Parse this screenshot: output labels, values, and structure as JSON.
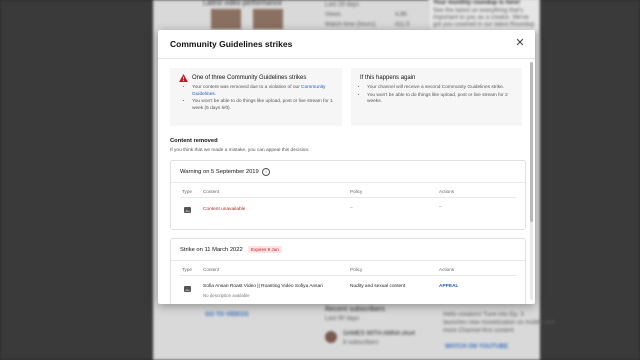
{
  "background": {
    "left_items": [
      "Latest video performance"
    ],
    "stats": [
      "Last 28 days",
      "Views",
      "Watch time (hours)"
    ],
    "stat_values": [
      "4.8K",
      "411.5"
    ],
    "right_card": [
      "Your monthly roundup is here!",
      "See the latest on everything that's",
      "important to you as a creator. We've",
      "got you covered in our latest Roundup"
    ],
    "go_to_videos": "GO TO VIDEOS",
    "recent_subscribers": "Recent subscribers",
    "last_90_days": "Last 90 days",
    "subscriber_name": "GAMES WITH AMNA short",
    "subscriber_meta": "8 subscribers",
    "right_bottom_text": [
      "Hello creators! Tune into Ep. 3",
      "launches new monetization on mobile and",
      "more Channel-first content"
    ],
    "watch_on_youtube": "WATCH ON YOUTUBE"
  },
  "modal": {
    "title": "Community Guidelines strikes",
    "close_icon": "close-icon",
    "strike_box": {
      "title": "One of three Community Guidelines strikes",
      "bullet1_prefix": "Your content was removed due to a violation of our ",
      "bullet1_link": "Community Guidelines",
      "bullet1_suffix": ".",
      "bullet2": "You won't be able to do things like upload, post or live stream for 1 week (5 days left)."
    },
    "again_box": {
      "title": "If this happens again",
      "bullet1": "Your channel will receive a second Community Guidelines strike.",
      "bullet2": "You won't be able to do things like upload, post or live stream for 2 weeks."
    },
    "content_removed": {
      "title": "Content removed",
      "subtitle": "If you think that we made a mistake, you can appeal this decision."
    },
    "warning_card": {
      "title": "Warning on 5 September 2019",
      "headers": {
        "type": "Type",
        "content": "Content",
        "policy": "Policy",
        "actions": "Actions"
      },
      "row": {
        "content": "Content unavailable",
        "policy": "–",
        "actions": "–"
      }
    },
    "strike_card": {
      "title": "Strike on 11 March 2022",
      "badge": "Expires 9 Jun",
      "headers": {
        "type": "Type",
        "content": "Content",
        "policy": "Policy",
        "actions": "Actions"
      },
      "row": {
        "content": "Sofia Ansari Roast Video || Roasting Video Sofiya Ansari",
        "description": "No description available",
        "policy": "Nudity and sexual content",
        "action": "APPEAL"
      }
    }
  },
  "colors": {
    "accent_link": "#1a5bc4",
    "warning_red": "#c4182b",
    "badge_bg": "#fde3e3"
  }
}
